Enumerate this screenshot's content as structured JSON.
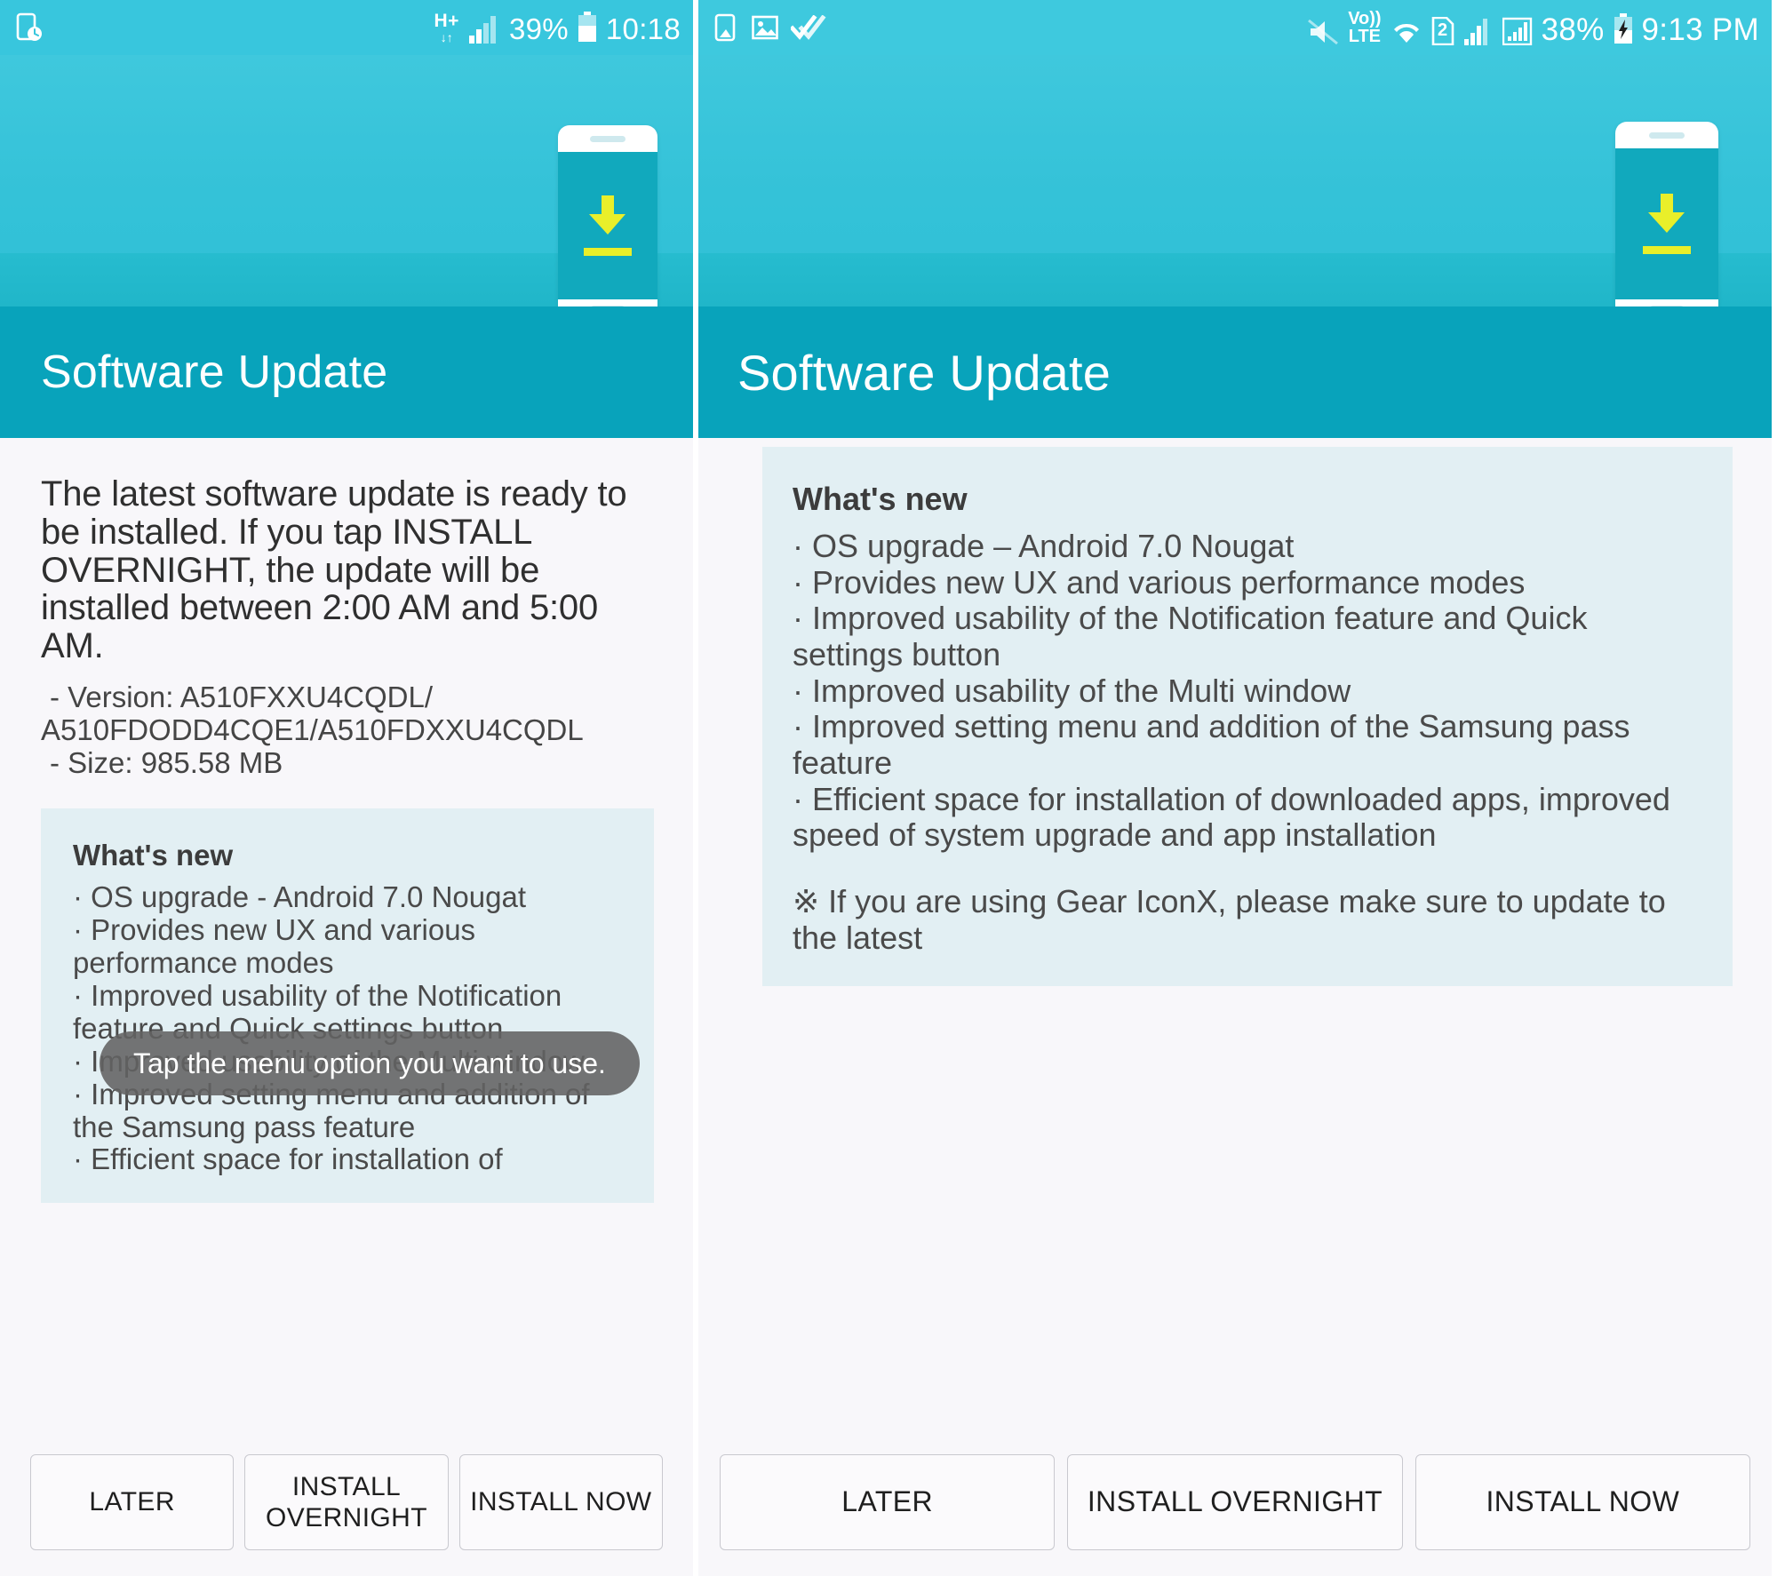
{
  "left": {
    "status_bar": {
      "left_icons": [
        "clock-phone-icon"
      ],
      "network_type": "H+",
      "network_arrows": "↓↑",
      "signal_icon": "signal-bars-icon",
      "battery_percent": "39%",
      "battery_icon": "battery-icon",
      "time": "10:18"
    },
    "hero": {
      "illustration": "phone-download-icon"
    },
    "title": "Software Update",
    "intro": "The latest software update is ready to be installed. If you tap INSTALL OVERNIGHT, the update will be installed between 2:00 AM and 5:00 AM.",
    "meta": [
      " - Version: A510FXXU4CQDL/",
      "A510FDODD4CQE1/A510FDXXU4CQDL",
      " - Size: 985.58 MB"
    ],
    "whats_new_title": "What's new",
    "whats_new_items": [
      "· OS upgrade - Android 7.0 Nougat",
      "· Provides new UX and various performance modes",
      "· Improved usability of the Notification feature and Quick settings button",
      "· Improved usability of the Multi window",
      "· Improved setting menu and addition of the Samsung pass feature",
      "· Efficient space for installation of"
    ],
    "toast": "Tap the menu option you want to use.",
    "buttons": [
      "LATER",
      "INSTALL OVERNIGHT",
      "INSTALL NOW"
    ]
  },
  "right": {
    "status_bar": {
      "left_icons": [
        "screenshot-icon",
        "image-icon",
        "double-check-icon"
      ],
      "mute_icon": "mute-icon",
      "volte_line1": "Vo))",
      "volte_line2": "LTE",
      "wifi_icon": "wifi-icon",
      "sim_label": "2",
      "signal_icon": "signal-bars-icon",
      "signal_boxed_icon": "signal-bars-boxed-icon",
      "battery_percent": "38%",
      "battery_icon": "battery-charging-icon",
      "time": "9:13 PM"
    },
    "hero": {
      "illustration": "phone-download-icon"
    },
    "title": "Software Update",
    "whats_new_title": "What's new",
    "whats_new_items": [
      "· OS upgrade – Android 7.0 Nougat",
      "· Provides new UX and various performance modes",
      "· Improved usability of the Notification feature and Quick settings button",
      "· Improved usability of the Multi window",
      "· Improved setting menu and addition of the Samsung pass feature",
      "· Efficient space for installation of downloaded apps, improved speed of system upgrade and app installation"
    ],
    "note": "※ If you are using Gear IconX, please make sure to update to the latest",
    "buttons": [
      "LATER",
      "INSTALL OVERNIGHT",
      "INSTALL NOW"
    ]
  },
  "colors": {
    "status_bar": "#38c6dd",
    "title_bar": "#08a3bb",
    "whats_new_bg": "#e2eff3",
    "accent_yellow": "#e9ef2a",
    "device_screen": "#11a9bd"
  }
}
